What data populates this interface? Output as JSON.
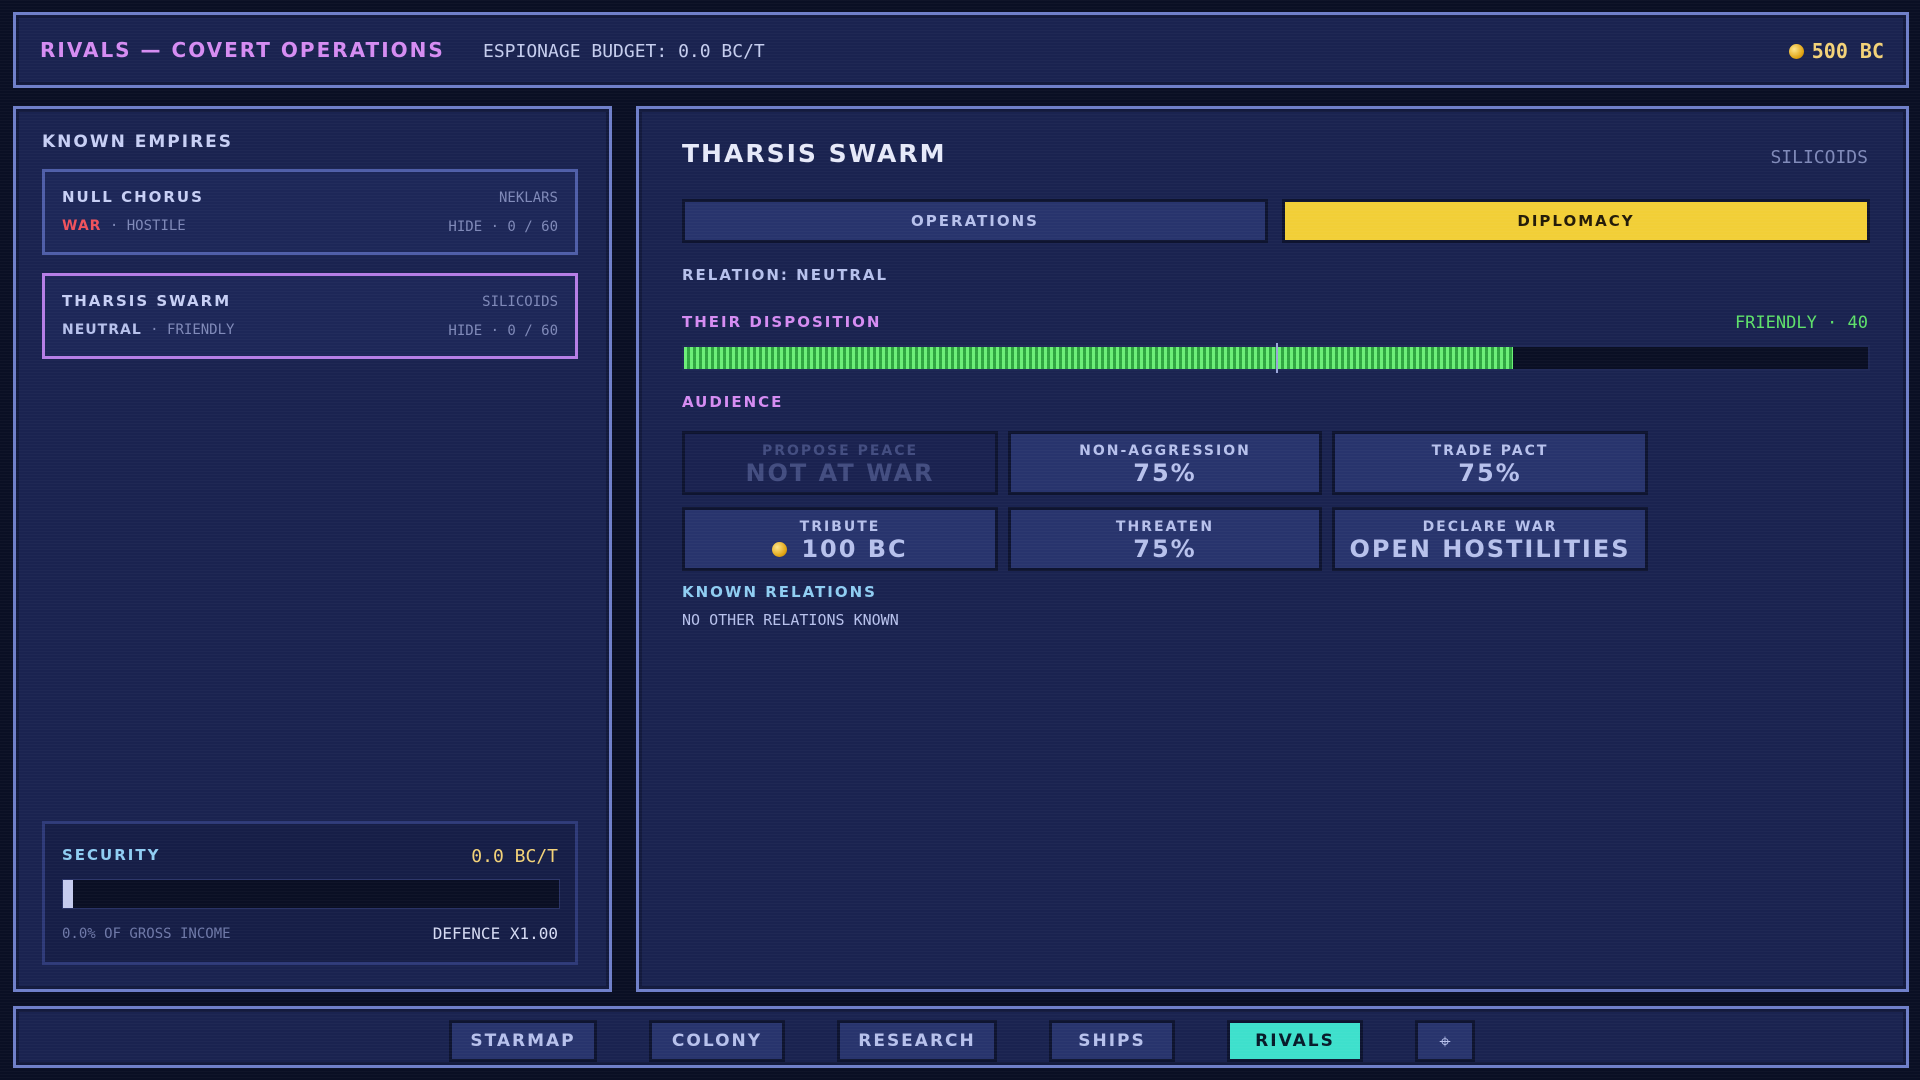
{
  "topbar": {
    "title": "RIVALS — COVERT OPERATIONS",
    "budget": "ESPIONAGE BUDGET: 0.0 BC/T",
    "credits": "500 BC"
  },
  "left": {
    "title": "KNOWN EMPIRES",
    "empires": [
      {
        "name": "NULL CHORUS",
        "race": "NEKLARS",
        "relation": "WAR",
        "disposition": "HOSTILE",
        "spy": "HIDE · 0 / 60",
        "relation_color": "#f0525c",
        "selected": false
      },
      {
        "name": "THARSIS SWARM",
        "race": "SILICOIDS",
        "relation": "NEUTRAL",
        "disposition": "FRIENDLY",
        "spy": "HIDE · 0 / 60",
        "relation_color": "#b7c1ec",
        "selected": true
      }
    ],
    "security": {
      "title": "SECURITY",
      "value": "0.0 BC/T",
      "level_fraction": 0.0,
      "percent_text": "0.0% OF GROSS INCOME",
      "defence": "DEFENCE X1.00"
    }
  },
  "right": {
    "empire_name": "THARSIS SWARM",
    "race": "SILICOIDS",
    "tabs": [
      {
        "label": "OPERATIONS",
        "active": false
      },
      {
        "label": "DIPLOMACY",
        "active": true
      }
    ],
    "relation_text": "RELATION: NEUTRAL",
    "disposition_label": "THEIR DISPOSITION",
    "disposition_value": "FRIENDLY · 40",
    "disposition_score": 40,
    "disposition_range": [
      -100,
      100
    ],
    "audience_label": "AUDIENCE",
    "actions": [
      {
        "top": "PROPOSE PEACE",
        "bottom": "NOT AT WAR",
        "enabled": false,
        "coin": false
      },
      {
        "top": "NON-AGGRESSION",
        "bottom": "75%",
        "enabled": true,
        "coin": false
      },
      {
        "top": "TRADE PACT",
        "bottom": "75%",
        "enabled": true,
        "coin": false
      },
      {
        "top": "TRIBUTE",
        "bottom": "100 BC",
        "enabled": true,
        "coin": true
      },
      {
        "top": "THREATEN",
        "bottom": "75%",
        "enabled": true,
        "coin": false
      },
      {
        "top": "DECLARE WAR",
        "bottom": "OPEN HOSTILITIES",
        "enabled": true,
        "coin": false
      }
    ],
    "known_relations_label": "KNOWN RELATIONS",
    "known_relations_text": "NO OTHER RELATIONS KNOWN"
  },
  "nav": [
    {
      "label": "STARMAP",
      "active": false
    },
    {
      "label": "COLONY",
      "active": false
    },
    {
      "label": "RESEARCH",
      "active": false
    },
    {
      "label": "SHIPS",
      "active": false
    },
    {
      "label": "RIVALS",
      "active": true
    }
  ],
  "settings_icon": "crosshair-icon"
}
